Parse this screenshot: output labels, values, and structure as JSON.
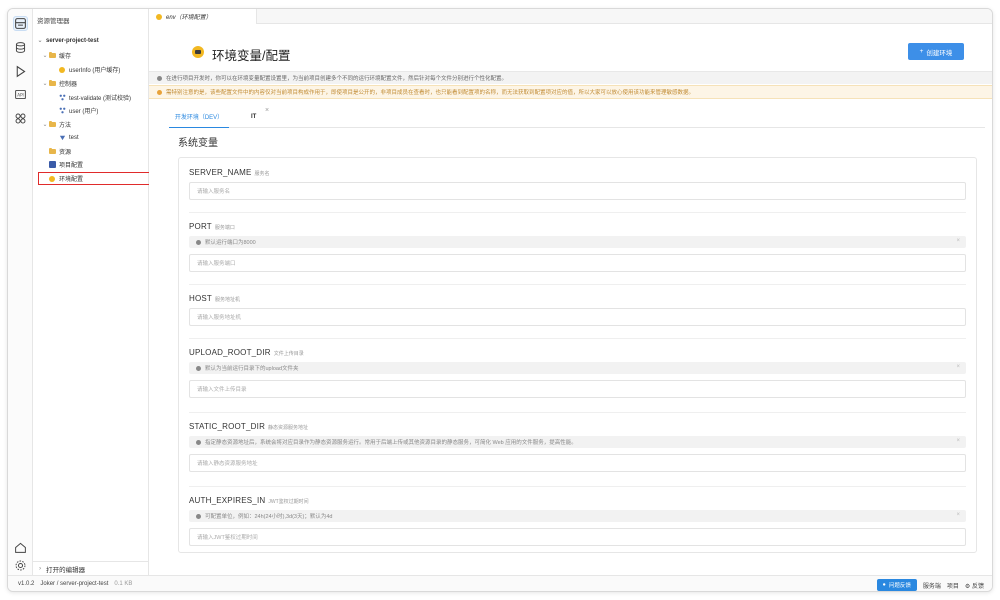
{
  "explorer": {
    "title": "资源管理器",
    "project": "server-project-test",
    "items": [
      {
        "label": "缓存",
        "kind": "folder"
      },
      {
        "label": "userInfo (用户缓存)",
        "kind": "yellow"
      },
      {
        "label": "控制器",
        "kind": "folder"
      },
      {
        "label": "test-validate (测试校验)",
        "kind": "node"
      },
      {
        "label": "user (用户)",
        "kind": "node"
      },
      {
        "label": "方法",
        "kind": "folder"
      },
      {
        "label": "test",
        "kind": "node"
      },
      {
        "label": "资源",
        "kind": "folder"
      },
      {
        "label": "项目配置",
        "kind": "ab"
      },
      {
        "label": "环境配置",
        "kind": "yellow"
      }
    ],
    "open_editors": "打开的编辑器"
  },
  "tab": {
    "label": "env（环境配置）"
  },
  "header": {
    "title": "环境变量/配置",
    "create_button": "创建环境"
  },
  "info_text": "在进行项目开发时，你可以在环境变量配置设置里，为当前项目创建多个不同的运行环境配置文件，然后针对每个文件分别进行个性化配置。",
  "warning_text": "需特别注意的是，该些配置文件中的内容仅对当前项目构成作用于，即使项目是公开的，非项目成员在查看时，也只能看到配置项的名称，而无法获取到配置项对应的值，所以大家可以放心使用该功能来管理敏感数据。",
  "env_tabs": [
    {
      "label": "开发环境（DEV）"
    },
    {
      "label": "IT"
    }
  ],
  "env_close": "×",
  "section_title": "系统变量",
  "fields": [
    {
      "name": "SERVER_NAME",
      "desc": "服务名",
      "note": "",
      "placeholder": "请输入服务名"
    },
    {
      "name": "PORT",
      "desc": "服务端口",
      "note": "默认运行端口为8000",
      "placeholder": "请输入服务端口"
    },
    {
      "name": "HOST",
      "desc": "服务地址机",
      "note": "",
      "placeholder": "请输入服务地址机"
    },
    {
      "name": "UPLOAD_ROOT_DIR",
      "desc": "文件上传目录",
      "note": "默认为当前运行目录下的upload文件夹",
      "placeholder": "请输入文件上传目录"
    },
    {
      "name": "STATIC_ROOT_DIR",
      "desc": "静态资源服务地址",
      "note": "指定静态资源地址后，系统会将对应目录作为静态资源服务运行。常用于后端上传或其他资源目录的静态服务，可简化 Web 应用的文件服务，提高性能。",
      "placeholder": "请输入静态资源服务地址"
    },
    {
      "name": "AUTH_EXPIRES_IN",
      "desc": "JWT鉴权过期时间",
      "note": "可配置单位，例如：24h(24小时),3d(3天)；默认为4d",
      "placeholder": "请输入JWT鉴权过期时间"
    }
  ],
  "status": {
    "version": "v1.0.2",
    "path": "Joker / server-project-test",
    "size": "0.1 KB",
    "feedback_button": "问题反馈",
    "links": [
      "服务端",
      "项目",
      "反馈"
    ]
  }
}
